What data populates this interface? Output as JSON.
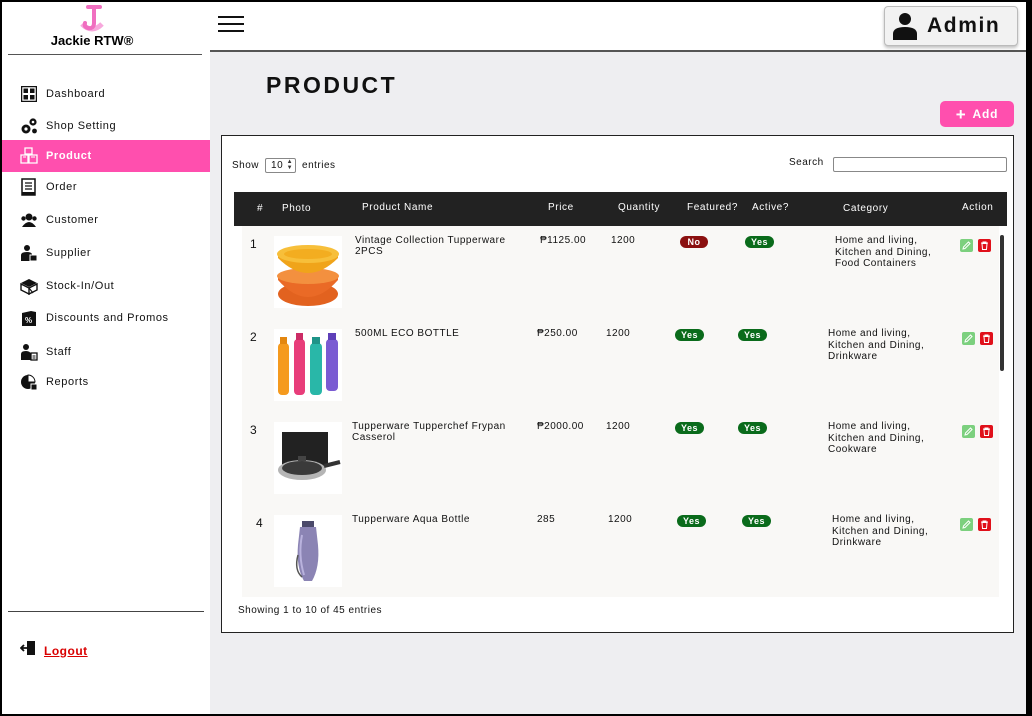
{
  "brand": {
    "name": "Jackie RTW®",
    "logo_letter": "J",
    "logo_color": "#f06fc0"
  },
  "sidebar": {
    "items": [
      {
        "label": "Dashboard",
        "icon": "grid-icon",
        "active": false
      },
      {
        "label": "Shop Setting",
        "icon": "gears-icon",
        "active": false
      },
      {
        "label": "Product",
        "icon": "boxes-icon",
        "active": true
      },
      {
        "label": "Order",
        "icon": "clipboard-icon",
        "active": false
      },
      {
        "label": "Customer",
        "icon": "users-icon",
        "active": false
      },
      {
        "label": "Supplier",
        "icon": "supplier-icon",
        "active": false
      },
      {
        "label": "Stock-In/Out",
        "icon": "box-icon",
        "active": false
      },
      {
        "label": "Discounts and Promos",
        "icon": "discount-icon",
        "active": false
      },
      {
        "label": "Staff",
        "icon": "staff-icon",
        "active": false
      },
      {
        "label": "Reports",
        "icon": "reports-icon",
        "active": false
      }
    ],
    "logout_label": "Logout"
  },
  "header": {
    "admin_label": "Admin"
  },
  "page": {
    "title": "PRODUCT",
    "add_label": "Add"
  },
  "table_controls": {
    "show_label": "Show",
    "show_value": "10",
    "entries_label": "entries",
    "search_label": "Search",
    "search_value": ""
  },
  "table": {
    "columns": [
      "#",
      "Photo",
      "Product Name",
      "Price",
      "Quantity",
      "Featured?",
      "Active?",
      "Category",
      "Action"
    ],
    "rows": [
      {
        "num": "1",
        "name": "Vintage Collection Tupperware 2PCS",
        "price": "₱1125.00",
        "quantity": "1200",
        "featured": "No",
        "active": "Yes",
        "category": "Home and living, Kitchen and Dining, Food Containers",
        "photo": "orange-bowls"
      },
      {
        "num": "2",
        "name": "500ML ECO BOTTLE",
        "price": "₱250.00",
        "quantity": "1200",
        "featured": "Yes",
        "active": "Yes",
        "category": "Home and living, Kitchen and Dining, Drinkware",
        "photo": "bottles"
      },
      {
        "num": "3",
        "name": "Tupperware Tupperchef Frypan Casserol",
        "price": "₱2000.00",
        "quantity": "1200",
        "featured": "Yes",
        "active": "Yes",
        "category": "Home and living, Kitchen and Dining, Cookware",
        "photo": "frypan"
      },
      {
        "num": "4",
        "name": "Tupperware Aqua Bottle",
        "price": "285",
        "quantity": "1200",
        "featured": "Yes",
        "active": "Yes",
        "category": "Home and living, Kitchen and Dining, Drinkware",
        "photo": "aqua-bottle"
      }
    ],
    "footer": "Showing 1 to 10 of 45 entries"
  },
  "colors": {
    "accent": "#ff4fae",
    "yes_badge": "#0a6b1b",
    "no_badge": "#8b1010",
    "header_bg": "#222222",
    "logout": "#d90000"
  }
}
